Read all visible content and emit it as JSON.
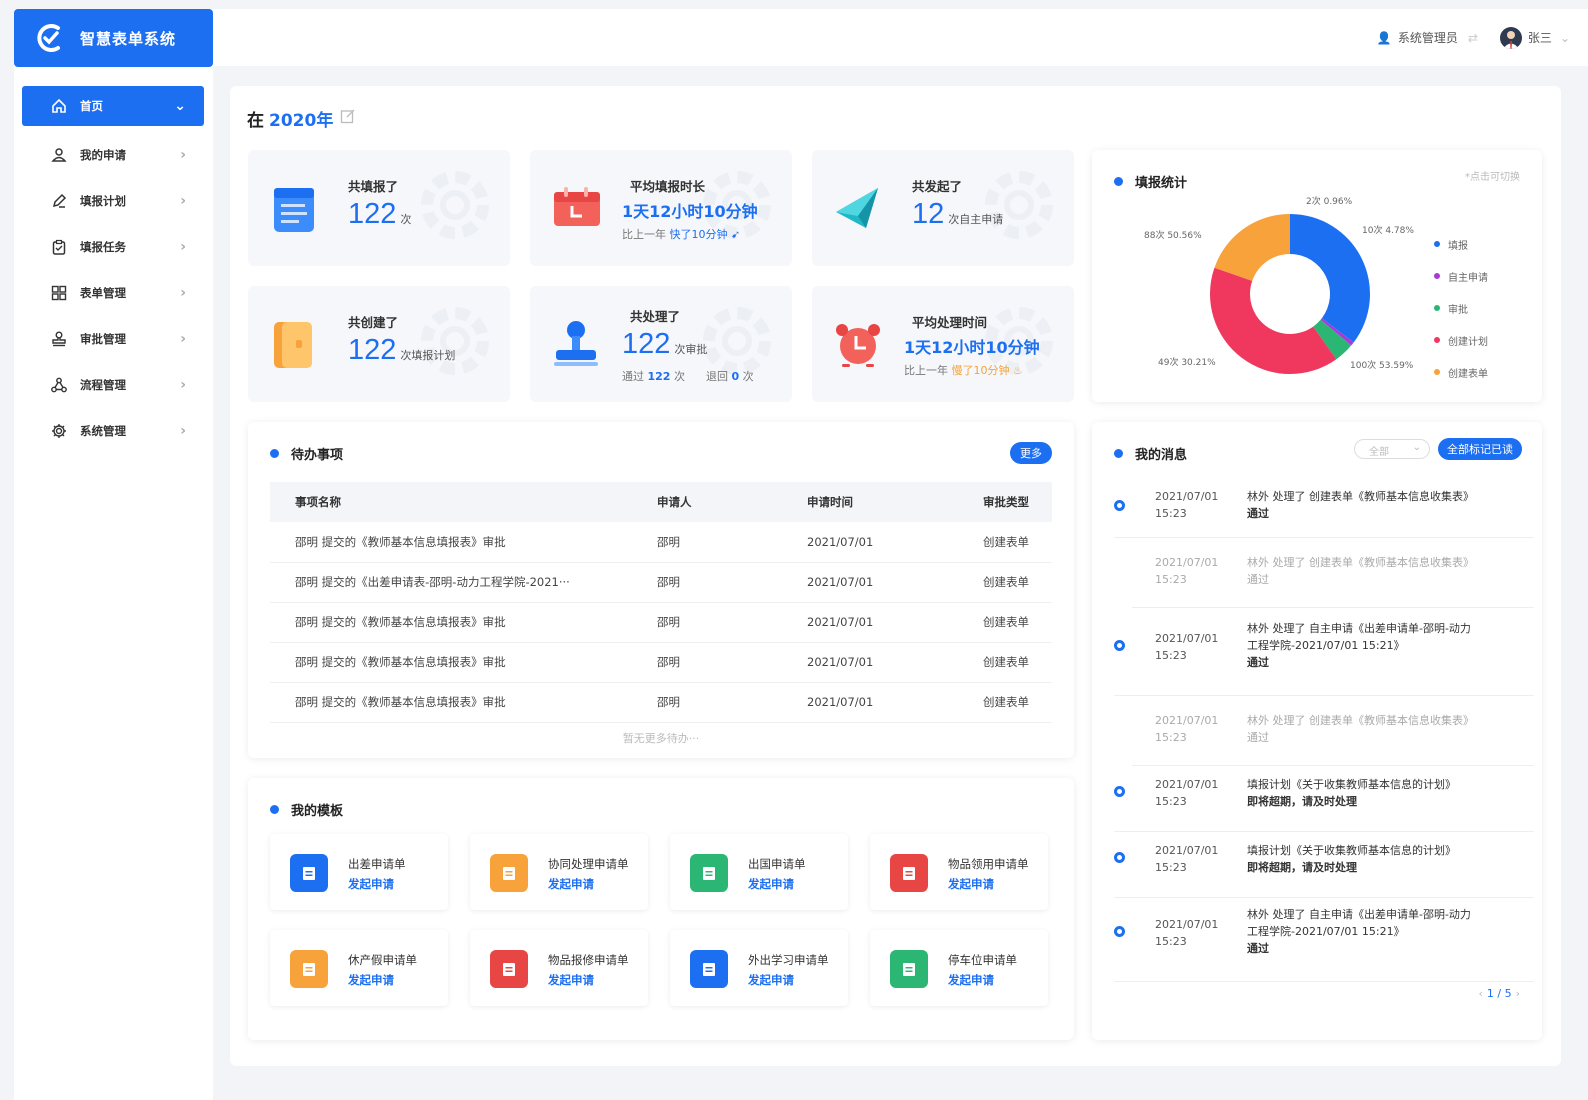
{
  "app": {
    "title": "智慧表单系统"
  },
  "menu": [
    {
      "label": "首页",
      "icon": "home-icon"
    },
    {
      "label": "我的申请",
      "icon": "user-icon"
    },
    {
      "label": "填报计划",
      "icon": "pen-icon"
    },
    {
      "label": "填报任务",
      "icon": "clipboard-icon"
    },
    {
      "label": "表单管理",
      "icon": "grid-icon"
    },
    {
      "label": "审批管理",
      "icon": "stamp-icon"
    },
    {
      "label": "流程管理",
      "icon": "flow-icon"
    },
    {
      "label": "系统管理",
      "icon": "gear-icon"
    }
  ],
  "topbar": {
    "role": "系统管理员",
    "user": "张三"
  },
  "year": {
    "prefix": "在",
    "value": "2020年"
  },
  "stats": {
    "filled": {
      "title": "共填报了",
      "value": "122",
      "unit": "次"
    },
    "avg_fill": {
      "title": "平均填报时长",
      "value": "1天12小时10分钟",
      "compare_prefix": "比上一年",
      "compare": "快了10分钟"
    },
    "initiated": {
      "title": "共发起了",
      "value": "12",
      "unit": "次自主申请"
    },
    "created": {
      "title": "共创建了",
      "value": "122",
      "unit": "次填报计划"
    },
    "processed": {
      "title": "共处理了",
      "value": "122",
      "unit": "次审批",
      "pass_label": "通过",
      "pass": "122",
      "pass_unit": "次",
      "reject_label": "退回",
      "reject": "0",
      "reject_unit": "次"
    },
    "avg_process": {
      "title": "平均处理时间",
      "value": "1天12小时10分钟",
      "compare_prefix": "比上一年",
      "compare": "慢了10分钟"
    }
  },
  "fill_stats": {
    "title": "填报统计",
    "hint": "*点击可切换",
    "labels": [
      "2次 0.96%",
      "10次 4.78%",
      "100次 53.59%",
      "49次 30.21%",
      "88次 50.56%"
    ]
  },
  "chart_data": {
    "type": "pie",
    "title": "填报统计",
    "series": [
      {
        "name": "填报",
        "value": 88,
        "color": "#1d6ff2"
      },
      {
        "name": "自主申请",
        "value": 2,
        "color": "#a43cd9"
      },
      {
        "name": "审批",
        "value": 10,
        "color": "#2bb673"
      },
      {
        "name": "创建计划",
        "value": 100,
        "color": "#f0385f"
      },
      {
        "name": "创建表单",
        "value": 49,
        "color": "#f7a23a"
      }
    ]
  },
  "todo": {
    "title": "待办事项",
    "more": "更多",
    "columns": [
      "事项名称",
      "申请人",
      "申请时间",
      "审批类型"
    ],
    "rows": [
      [
        "邵明 提交的《教师基本信息填报表》审批",
        "邵明",
        "2021/07/01",
        "创建表单"
      ],
      [
        "邵明 提交的《出差申请表-邵明-动力工程学院-2021···",
        "邵明",
        "2021/07/01",
        "创建表单"
      ],
      [
        "邵明 提交的《教师基本信息填报表》审批",
        "邵明",
        "2021/07/01",
        "创建表单"
      ],
      [
        "邵明 提交的《教师基本信息填报表》审批",
        "邵明",
        "2021/07/01",
        "创建表单"
      ],
      [
        "邵明 提交的《教师基本信息填报表》审批",
        "邵明",
        "2021/07/01",
        "创建表单"
      ]
    ],
    "empty": "暂无更多待办···"
  },
  "templates": {
    "title": "我的模板",
    "action": "发起申请",
    "items": [
      {
        "name": "出差申请单",
        "color": "#1d6ff2"
      },
      {
        "name": "协同处理申请单",
        "color": "#f7a23a"
      },
      {
        "name": "出国申请单",
        "color": "#2bb673"
      },
      {
        "name": "物品领用申请单",
        "color": "#e84545"
      },
      {
        "name": "休产假申请单",
        "color": "#f7a23a"
      },
      {
        "name": "物品报修申请单",
        "color": "#e84545"
      },
      {
        "name": "外出学习申请单",
        "color": "#1d6ff2"
      },
      {
        "name": "停车位申请单",
        "color": "#2bb673"
      }
    ]
  },
  "messages": {
    "title": "我的消息",
    "filter": "全部",
    "mark_all": "全部标记已读",
    "pager": "1 / 5",
    "items": [
      {
        "date": "2021/07/01",
        "time": "15:23",
        "line1": "林外 处理了 创建表单《教师基本信息收集表》",
        "line2": "",
        "status": "通过",
        "unread": true
      },
      {
        "date": "2021/07/01",
        "time": "15:23",
        "line1": "林外 处理了 创建表单《教师基本信息收集表》",
        "line2": "",
        "status": "通过",
        "unread": false
      },
      {
        "date": "2021/07/01",
        "time": "15:23",
        "line1": "林外 处理了 自主申请《出差申请单-邵明-动力",
        "line2": "工程学院-2021/07/01 15:21》",
        "status": "通过",
        "unread": true
      },
      {
        "date": "2021/07/01",
        "time": "15:23",
        "line1": "林外 处理了 创建表单《教师基本信息收集表》",
        "line2": "",
        "status": "通过",
        "unread": false
      },
      {
        "date": "2021/07/01",
        "time": "15:23",
        "line1": "填报计划《关于收集教师基本信息的计划》",
        "line2": "",
        "status": "即将超期，请及时处理",
        "unread": true
      },
      {
        "date": "2021/07/01",
        "time": "15:23",
        "line1": "填报计划《关于收集教师基本信息的计划》",
        "line2": "",
        "status": "即将超期，请及时处理",
        "unread": true
      },
      {
        "date": "2021/07/01",
        "time": "15:23",
        "line1": "林外 处理了 自主申请《出差申请单-邵明-动力",
        "line2": "工程学院-2021/07/01 15:21》",
        "status": "通过",
        "unread": true
      }
    ]
  }
}
